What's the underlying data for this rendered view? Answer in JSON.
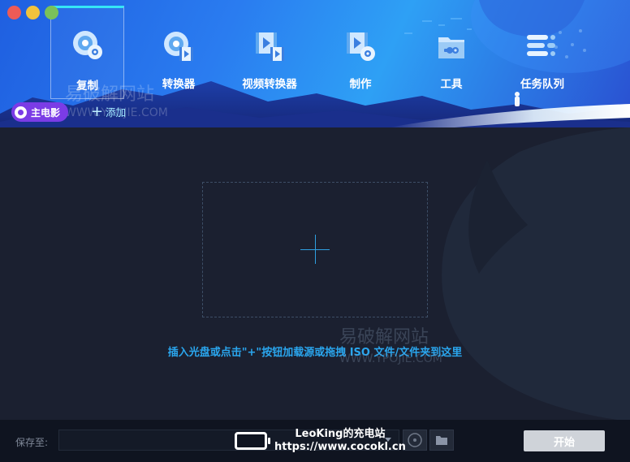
{
  "window": {
    "controls": [
      "close",
      "minimize",
      "zoom"
    ]
  },
  "nav": {
    "items": [
      {
        "label": "复制",
        "icon": "disc-copy-icon",
        "active": true
      },
      {
        "label": "转换器",
        "icon": "disc-convert-icon",
        "active": false
      },
      {
        "label": "视频转换器",
        "icon": "video-convert-icon",
        "active": false
      },
      {
        "label": "制作",
        "icon": "video-disc-create-icon",
        "active": false
      },
      {
        "label": "工具",
        "icon": "toolbox-icon",
        "active": false
      },
      {
        "label": "任务队列",
        "icon": "task-queue-icon",
        "active": false
      }
    ]
  },
  "source": {
    "main_movie_label": "主电影",
    "add_label": "添加"
  },
  "watermark": {
    "cn": "易破解网站",
    "en": "WWW.YPOJIE.COM"
  },
  "dropzone": {
    "hint": "插入光盘或点击\"+\"按钮加载源或拖拽 ISO 文件/文件夹到这里"
  },
  "footer": {
    "save_to_label": "保存至:",
    "path_value": "",
    "start_label": "开始"
  },
  "overlay": {
    "line1": "LeoKing的充电站",
    "line2": "https://www.cocokl.cn"
  },
  "colors": {
    "accent": "#2aa6ee",
    "main_movie": "#7b3ce6",
    "active_tab_border": "#35e6f5",
    "content_bg": "#1b2030"
  }
}
